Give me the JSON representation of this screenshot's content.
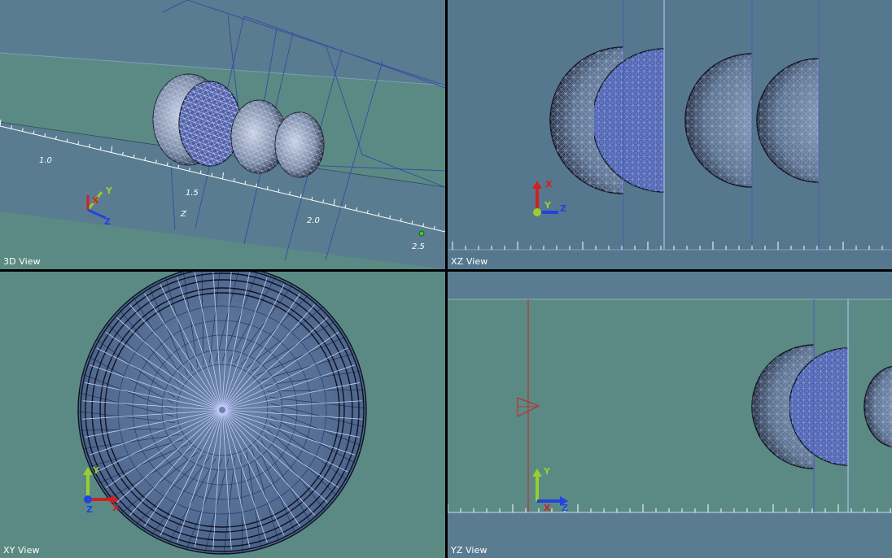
{
  "views": {
    "view_3d": {
      "label": "3D View"
    },
    "view_xz": {
      "label": "XZ View"
    },
    "view_xy": {
      "label": "XY View"
    },
    "view_yz": {
      "label": "YZ View"
    }
  },
  "ruler_3d": {
    "labels": [
      "1.0",
      "1.5",
      "2.0",
      "2.5"
    ],
    "axis_label": "Z"
  },
  "axes": {
    "x": "X",
    "y": "Y",
    "z": "Z",
    "colors": {
      "x": "#cc2222",
      "y": "#9acd32",
      "z": "#2244dd"
    }
  },
  "colors": {
    "viewport_3d": "#5a7c90",
    "viewport_xz": "#56788e",
    "viewport_flat": "#5b8a85",
    "mesh_light": "#b8c4ff",
    "mesh_dark": "#1a2030",
    "separator": "#000000"
  }
}
